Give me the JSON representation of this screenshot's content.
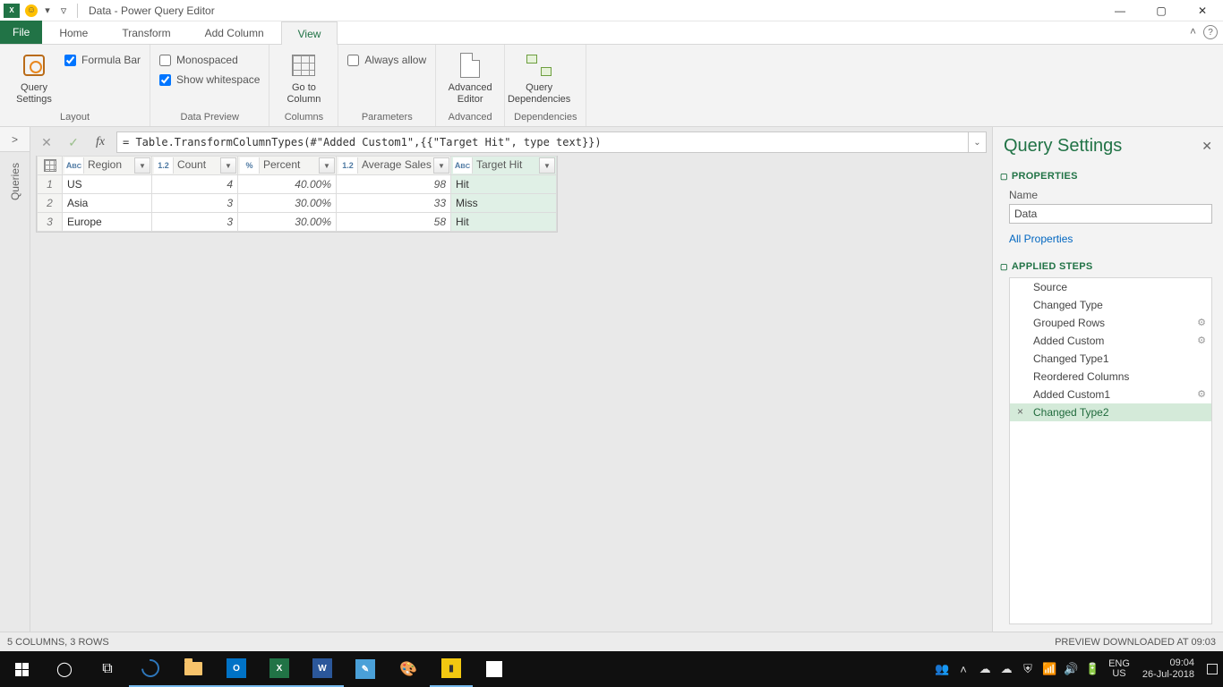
{
  "window": {
    "title": "Data - Power Query Editor"
  },
  "tabs": {
    "file": "File",
    "home": "Home",
    "transform": "Transform",
    "addColumn": "Add Column",
    "view": "View"
  },
  "ribbon": {
    "layout": {
      "label": "Layout",
      "querySettings": "Query\nSettings",
      "formulaBar": "Formula Bar"
    },
    "dataPreview": {
      "label": "Data Preview",
      "monospaced": "Monospaced",
      "showWhitespace": "Show whitespace"
    },
    "columns": {
      "label": "Columns",
      "goToColumn": "Go to\nColumn"
    },
    "parameters": {
      "label": "Parameters",
      "alwaysAllow": "Always allow"
    },
    "advanced": {
      "label": "Advanced",
      "editor": "Advanced\nEditor"
    },
    "dependencies": {
      "label": "Dependencies",
      "query": "Query\nDependencies"
    }
  },
  "leftStrip": {
    "label": "Queries"
  },
  "formulaBar": {
    "value": "= Table.TransformColumnTypes(#\"Added Custom1\",{{\"Target Hit\", type text}})"
  },
  "grid": {
    "columns": [
      {
        "name": "Region",
        "type": "abc",
        "cls": "Region-w"
      },
      {
        "name": "Count",
        "type": "1.2",
        "cls": "Count-w"
      },
      {
        "name": "Percent",
        "type": "%",
        "cls": "Percent-w"
      },
      {
        "name": "Average Sales",
        "type": "1.2",
        "cls": "Average-w"
      },
      {
        "name": "Target Hit",
        "type": "abc",
        "cls": "Target-w",
        "highlight": true
      }
    ],
    "rows": [
      {
        "n": "1",
        "Region": "US",
        "Count": "4",
        "Percent": "40.00%",
        "Average": "98",
        "Target": "Hit"
      },
      {
        "n": "2",
        "Region": "Asia",
        "Count": "3",
        "Percent": "30.00%",
        "Average": "33",
        "Target": "Miss"
      },
      {
        "n": "3",
        "Region": "Europe",
        "Count": "3",
        "Percent": "30.00%",
        "Average": "58",
        "Target": "Hit"
      }
    ]
  },
  "settings": {
    "title": "Query Settings",
    "propertiesHdr": "PROPERTIES",
    "nameLabel": "Name",
    "nameValue": "Data",
    "allProps": "All Properties",
    "stepsHdr": "APPLIED STEPS",
    "steps": [
      {
        "label": "Source",
        "gear": false
      },
      {
        "label": "Changed Type",
        "gear": false
      },
      {
        "label": "Grouped Rows",
        "gear": true
      },
      {
        "label": "Added Custom",
        "gear": true
      },
      {
        "label": "Changed Type1",
        "gear": false
      },
      {
        "label": "Reordered Columns",
        "gear": false
      },
      {
        "label": "Added Custom1",
        "gear": true
      },
      {
        "label": "Changed Type2",
        "gear": false,
        "selected": true
      }
    ]
  },
  "status": {
    "left": "5 COLUMNS, 3 ROWS",
    "right": "PREVIEW DOWNLOADED AT 09:03"
  },
  "taskbar": {
    "lang1": "ENG",
    "lang2": "US",
    "time": "09:04",
    "date": "26-Jul-2018"
  }
}
